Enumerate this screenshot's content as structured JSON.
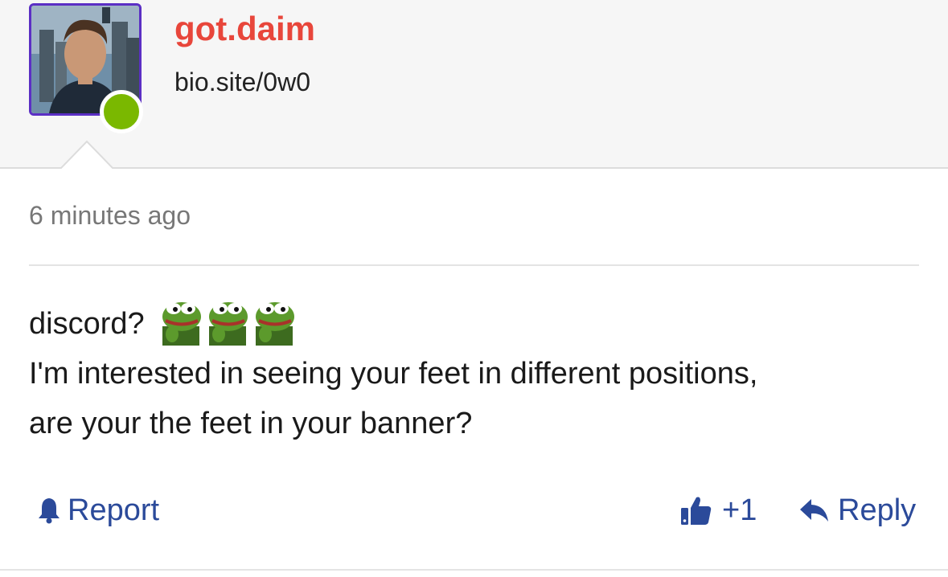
{
  "comment_header": {
    "username": "got.daim",
    "bio_link": "bio.site/0w0",
    "avatar_icon": "user-avatar-photo",
    "status": "online",
    "status_color": "#7ab800",
    "username_color": "#e8463b"
  },
  "comment": {
    "timestamp": "6 minutes ago",
    "line1_text": "discord?",
    "emotes": [
      "pepe-frog-emote",
      "pepe-frog-emote",
      "pepe-frog-emote"
    ],
    "body_line2": "I'm interested in seeing your feet in different positions,",
    "body_line3": "are your the feet in your banner?"
  },
  "actions": {
    "report_label": "Report",
    "report_icon": "bell-icon",
    "like_count": "+1",
    "like_icon": "thumbs-up-icon",
    "reply_label": "Reply",
    "reply_icon": "reply-arrow-icon",
    "accent_color": "#2b4a9a"
  }
}
